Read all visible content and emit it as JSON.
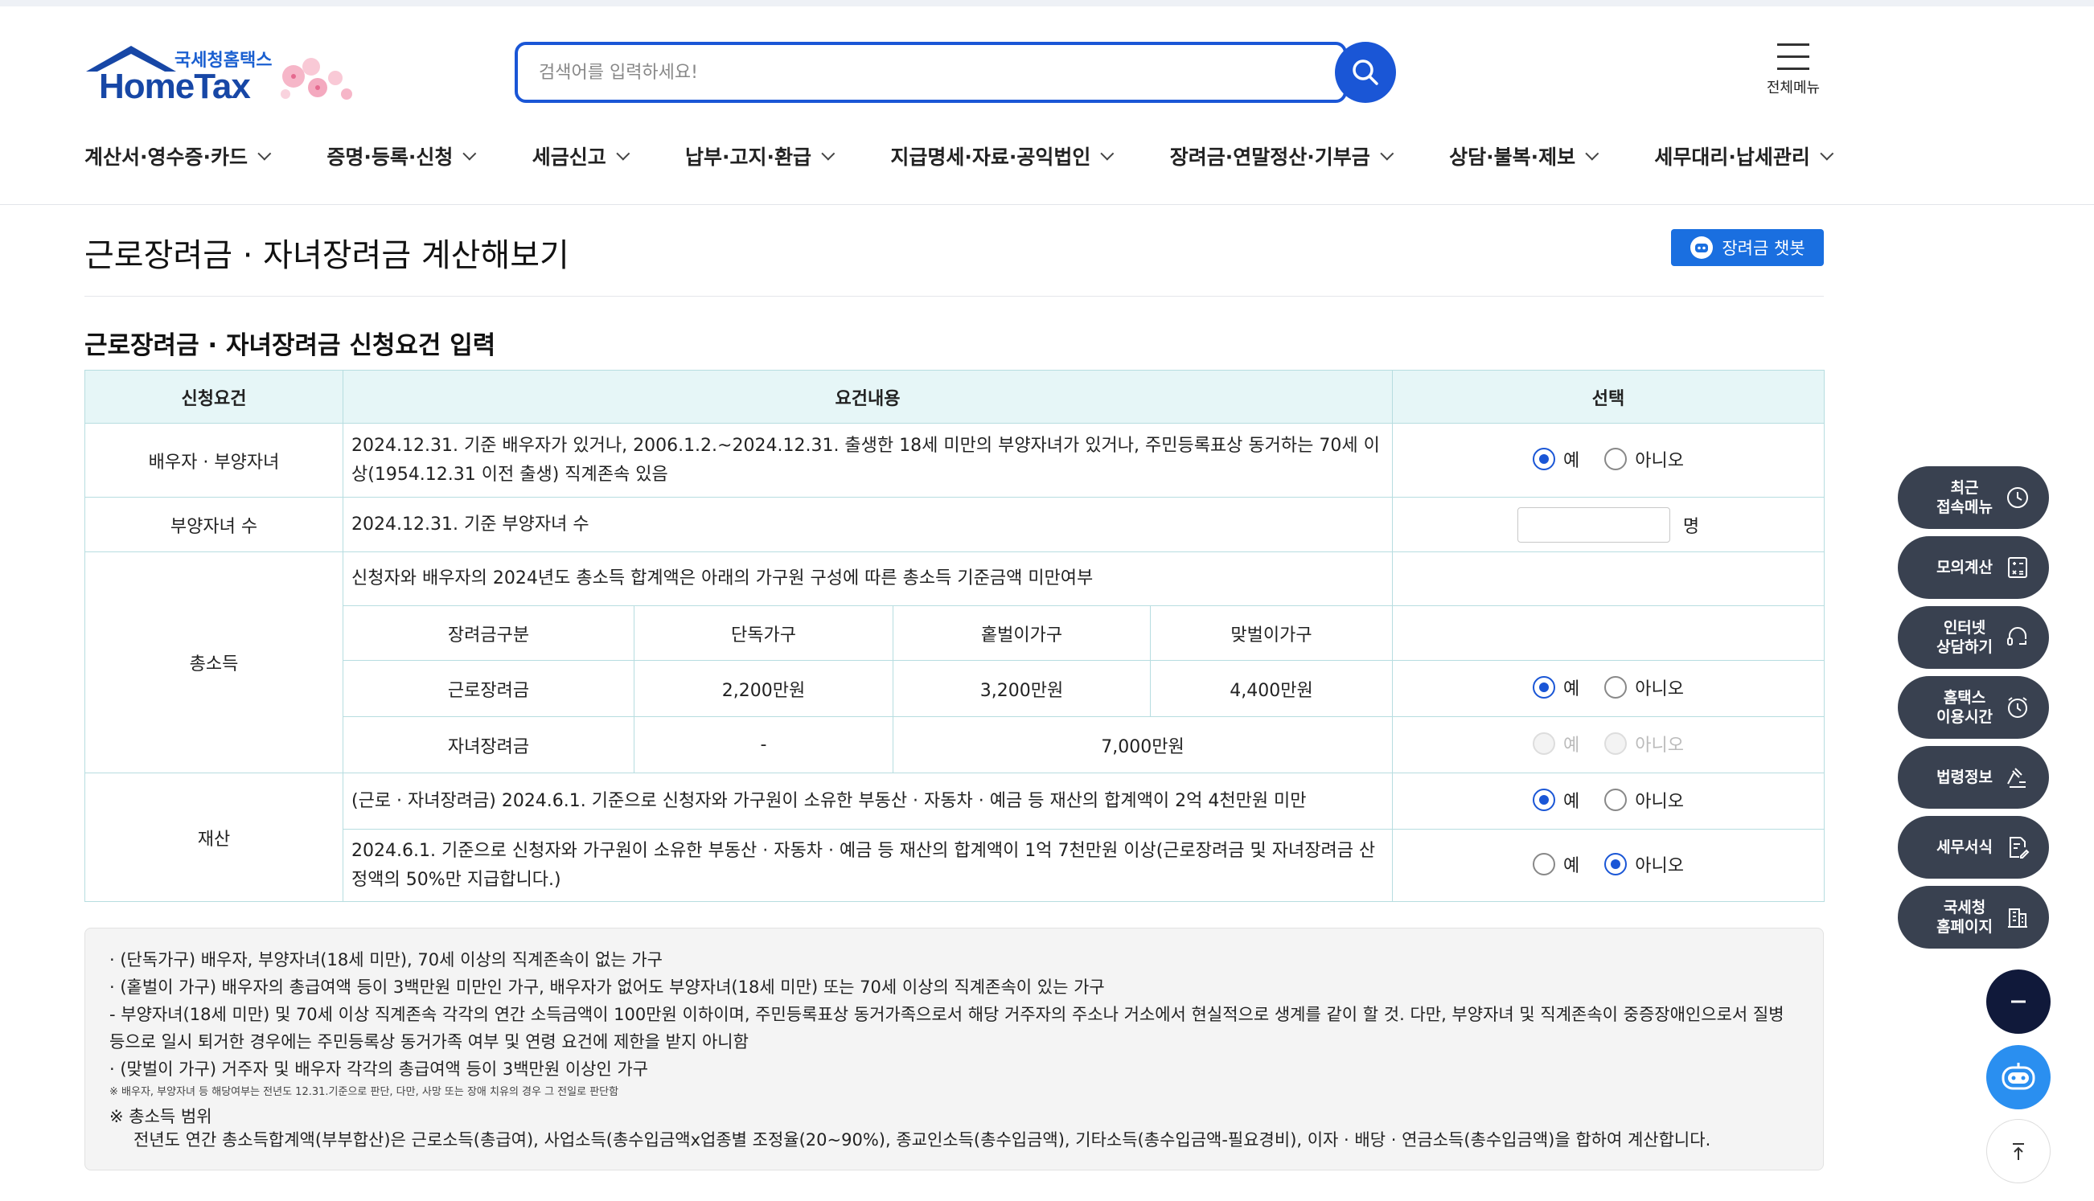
{
  "header": {
    "logo_kor": "국세청홈택스",
    "logo_en": "HomeTax",
    "search_placeholder": "검색어를 입력하세요!",
    "all_menu_label": "전체메뉴"
  },
  "nav": [
    "계산서·영수증·카드",
    "증명·등록·신청",
    "세금신고",
    "납부·고지·환급",
    "지급명세·자료·공익법인",
    "장려금·연말정산·기부금",
    "상담·불복·제보",
    "세무대리·납세관리"
  ],
  "page": {
    "title": "근로장려금 · 자녀장려금 계산해보기",
    "chatbot_button": "장려금 챗봇",
    "section_title": "근로장려금 · 자녀장려금 신청요건 입력"
  },
  "table": {
    "headers": [
      "신청요건",
      "요건내용",
      "선택"
    ],
    "radio_yes": "예",
    "radio_no": "아니오",
    "rows": {
      "spouse_label": "배우자 · 부양자녀",
      "spouse_text": "2024.12.31. 기준 배우자가 있거나, 2006.1.2.~2024.12.31. 출생한 18세 미만의 부양자녀가 있거나, 주민등록표상 동거하는 70세 이상(1954.12.31 이전 출생) 직계존속 있음",
      "children_label": "부양자녀 수",
      "children_text": "2024.12.31. 기준 부양자녀 수",
      "children_unit": "명",
      "income_label": "총소득",
      "income_text": "신청자와 배우자의 2024년도 총소득 합계액은 아래의 가구원 구성에 따른 총소득 기준금액 미만여부",
      "income_sub_headers": [
        "장려금구분",
        "단독가구",
        "홑벌이가구",
        "맞벌이가구"
      ],
      "work_label": "근로장려금",
      "work_values": [
        "2,200만원",
        "3,200만원",
        "4,400만원"
      ],
      "child_label": "자녀장려금",
      "child_values": [
        "-",
        "7,000만원"
      ],
      "property_label": "재산",
      "property_text_1": "(근로 · 자녀장려금) 2024.6.1. 기준으로 신청자와 가구원이 소유한 부동산 · 자동차 · 예금 등 재산의 합계액이 2억 4천만원 미만",
      "property_text_2": "2024.6.1. 기준으로 신청자와 가구원이 소유한 부동산 · 자동차 · 예금 등 재산의 합계액이 1억 7천만원 이상(근로장려금 및 자녀장려금 산정액의 50%만 지급합니다.)"
    }
  },
  "notes": {
    "lines": [
      "· (단독가구) 배우자, 부양자녀(18세 미만), 70세 이상의 직계존속이 없는 가구",
      "· (홑벌이 가구) 배우자의 총급여액 등이 3백만원 미만인 가구, 배우자가 없어도 부양자녀(18세 미만) 또는 70세 이상의 직계존속이 있는 가구",
      "- 부양자녀(18세 미만) 및 70세 이상 직계존속 각각의 연간 소득금액이 100만원 이하이며, 주민등록표상 동거가족으로서 해당 거주자의 주소나 거소에서 현실적으로 생계를 같이 할 것. 다만, 부양자녀 및 직계존속이 중증장애인으로서 질병 등으로 일시 퇴거한 경우에는 주민등록상 동거가족 여부 및 연령 요건에 제한을 받지 아니함",
      "· (맞벌이 가구) 거주자 및 배우자 각각의 총급여액 등이 3백만원 이상인 가구"
    ],
    "small": "※ 배우자, 부양자녀 등 해당여부는 전년도 12.31.기준으로 판단, 다만, 사망 또는 장애 치유의 경우 그 전일로 판단함",
    "range_title": "※ 총소득 범위",
    "range_text": "전년도 연간 총소득합계액(부부합산)은 근로소득(총급여), 사업소득(총수입금액x업종별 조정율(20~90%), 종교인소득(총수입금액), 기타소득(총수입금액-필요경비), 이자 · 배당 · 연금소득(총수입금액)을 합하여 계산합니다."
  },
  "quick_menu": [
    "최근\n접속메뉴",
    "모의계산",
    "인터넷\n상담하기",
    "홈택스\n이용시간",
    "법령정보",
    "세무서식",
    "국세청\n홈페이지"
  ],
  "colors": {
    "primary": "#1a56d6",
    "table_header_bg": "#e6f6f7",
    "table_border": "#b7dde0",
    "quick_bg": "#394150",
    "minus_bg": "#10193a",
    "chatbot_bg": "#2a8ff0"
  }
}
